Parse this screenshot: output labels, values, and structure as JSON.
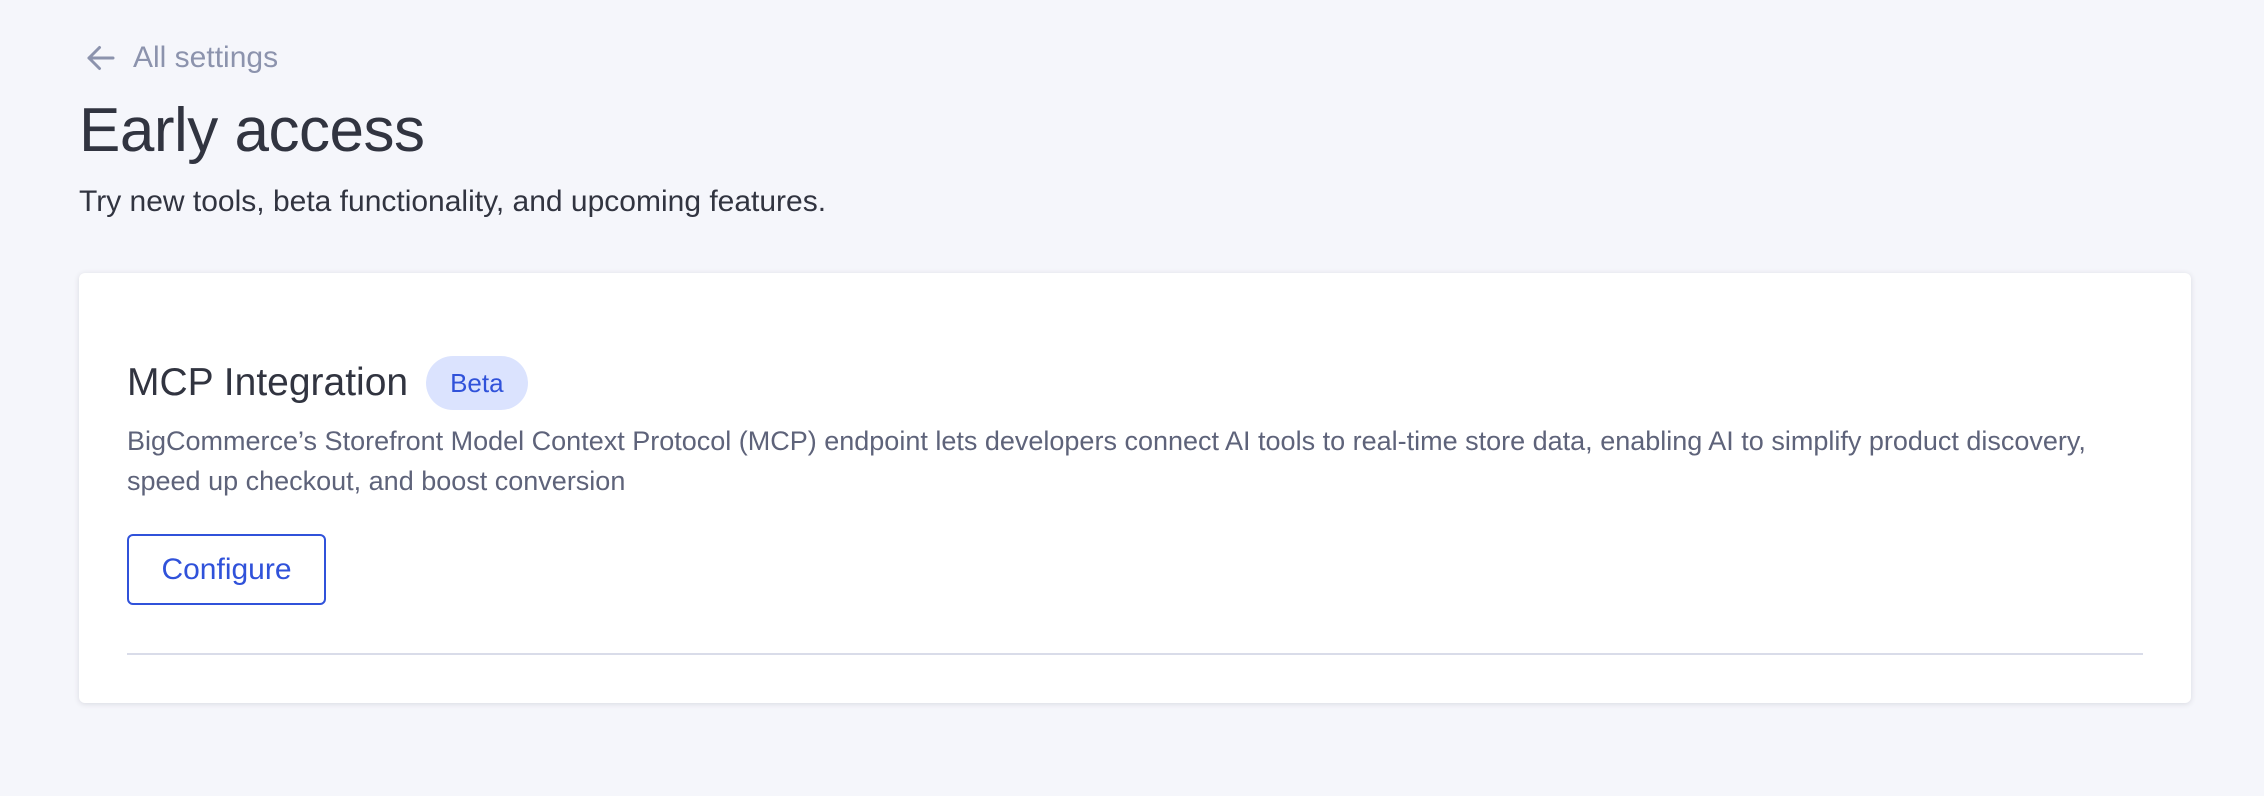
{
  "back_link": {
    "label": "All settings",
    "icon": "arrow-left-icon"
  },
  "header": {
    "title": "Early access",
    "subtitle": "Try new tools, beta functionality, and upcoming features."
  },
  "feature_card": {
    "title": "MCP Integration",
    "badge": "Beta",
    "description": "BigCommerce’s Storefront Model Context Protocol (MCP) endpoint lets developers connect AI tools to real-time store data, enabling AI to simplify product discovery, speed up checkout, and boost conversion",
    "configure_label": "Configure"
  },
  "colors": {
    "background": "#f5f6fb",
    "card": "#ffffff",
    "text_primary": "#313440",
    "text_secondary": "#5e637a",
    "text_muted": "#8c93ad",
    "accent": "#3052da",
    "badge_bg": "#dbe3fe",
    "divider": "#d9dce9"
  }
}
